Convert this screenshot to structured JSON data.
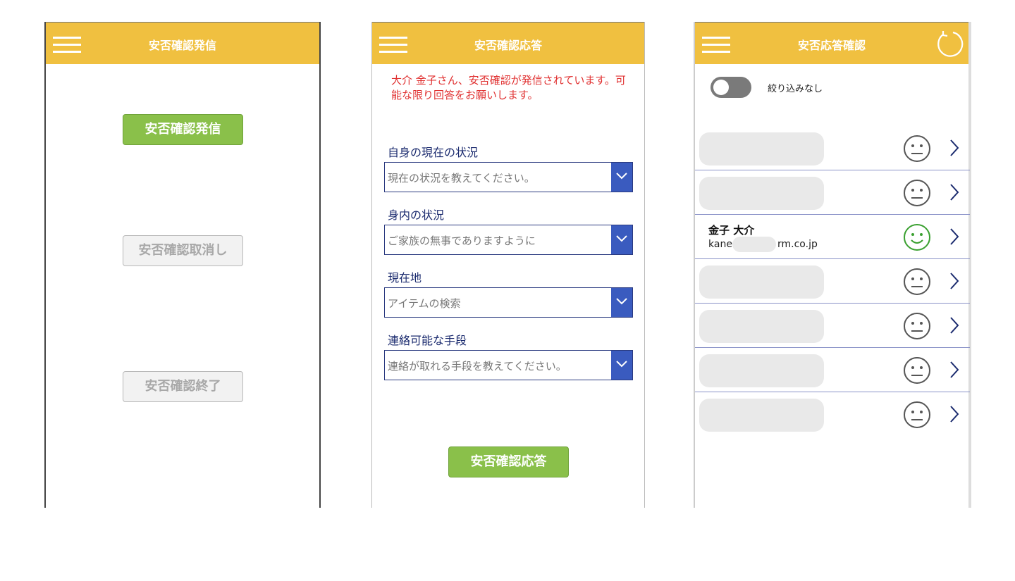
{
  "screen1": {
    "title": "安否確認発信",
    "send_button": "安否確認発信",
    "cancel_button": "安否確認取消し",
    "end_button": "安否確認終了"
  },
  "screen2": {
    "title": "安否確認応答",
    "notice": "大介 金子さん、安否確認が発信されています。可能な限り回答をお願いします。",
    "fields": [
      {
        "label": "自身の現在の状況",
        "placeholder": "現在の状況を教えてください。"
      },
      {
        "label": "身内の状況",
        "placeholder": "ご家族の無事でありますように"
      },
      {
        "label": "現在地",
        "placeholder": "アイテムの検索"
      },
      {
        "label": "連絡可能な手段",
        "placeholder": "連絡が取れる手段を教えてください。"
      }
    ],
    "submit_button": "安否確認応答"
  },
  "screen3": {
    "title": "安否応答確認",
    "filter_label": "絞り込みなし",
    "filter_on": false,
    "rows": [
      {
        "name": "",
        "email": "",
        "status": "neutral"
      },
      {
        "name": "",
        "email": "",
        "status": "neutral"
      },
      {
        "name": "金子 大介",
        "email_prefix": "kane",
        "email_suffix": "rm.co.jp",
        "status": "ok"
      },
      {
        "name": "",
        "email": "",
        "status": "neutral"
      },
      {
        "name": "",
        "email": "",
        "status": "neutral"
      },
      {
        "name": "",
        "email": "",
        "status": "neutral"
      },
      {
        "name": "",
        "email": "",
        "status": "neutral"
      }
    ]
  },
  "colors": {
    "header": "#f0c040",
    "button_green": "#8ac04a",
    "notice_red": "#e03030",
    "dropdown_blue": "#3a5bbf",
    "label_navy": "#1a2a6e",
    "ok_green": "#3aa030",
    "neutral_gray": "#555555"
  },
  "icons": {
    "menu": "hamburger-icon",
    "refresh": "refresh-icon",
    "dropdown": "chevron-down-icon",
    "row_arrow": "chevron-right-icon",
    "status_neutral": "neutral-face-icon",
    "status_ok": "smile-face-icon"
  }
}
